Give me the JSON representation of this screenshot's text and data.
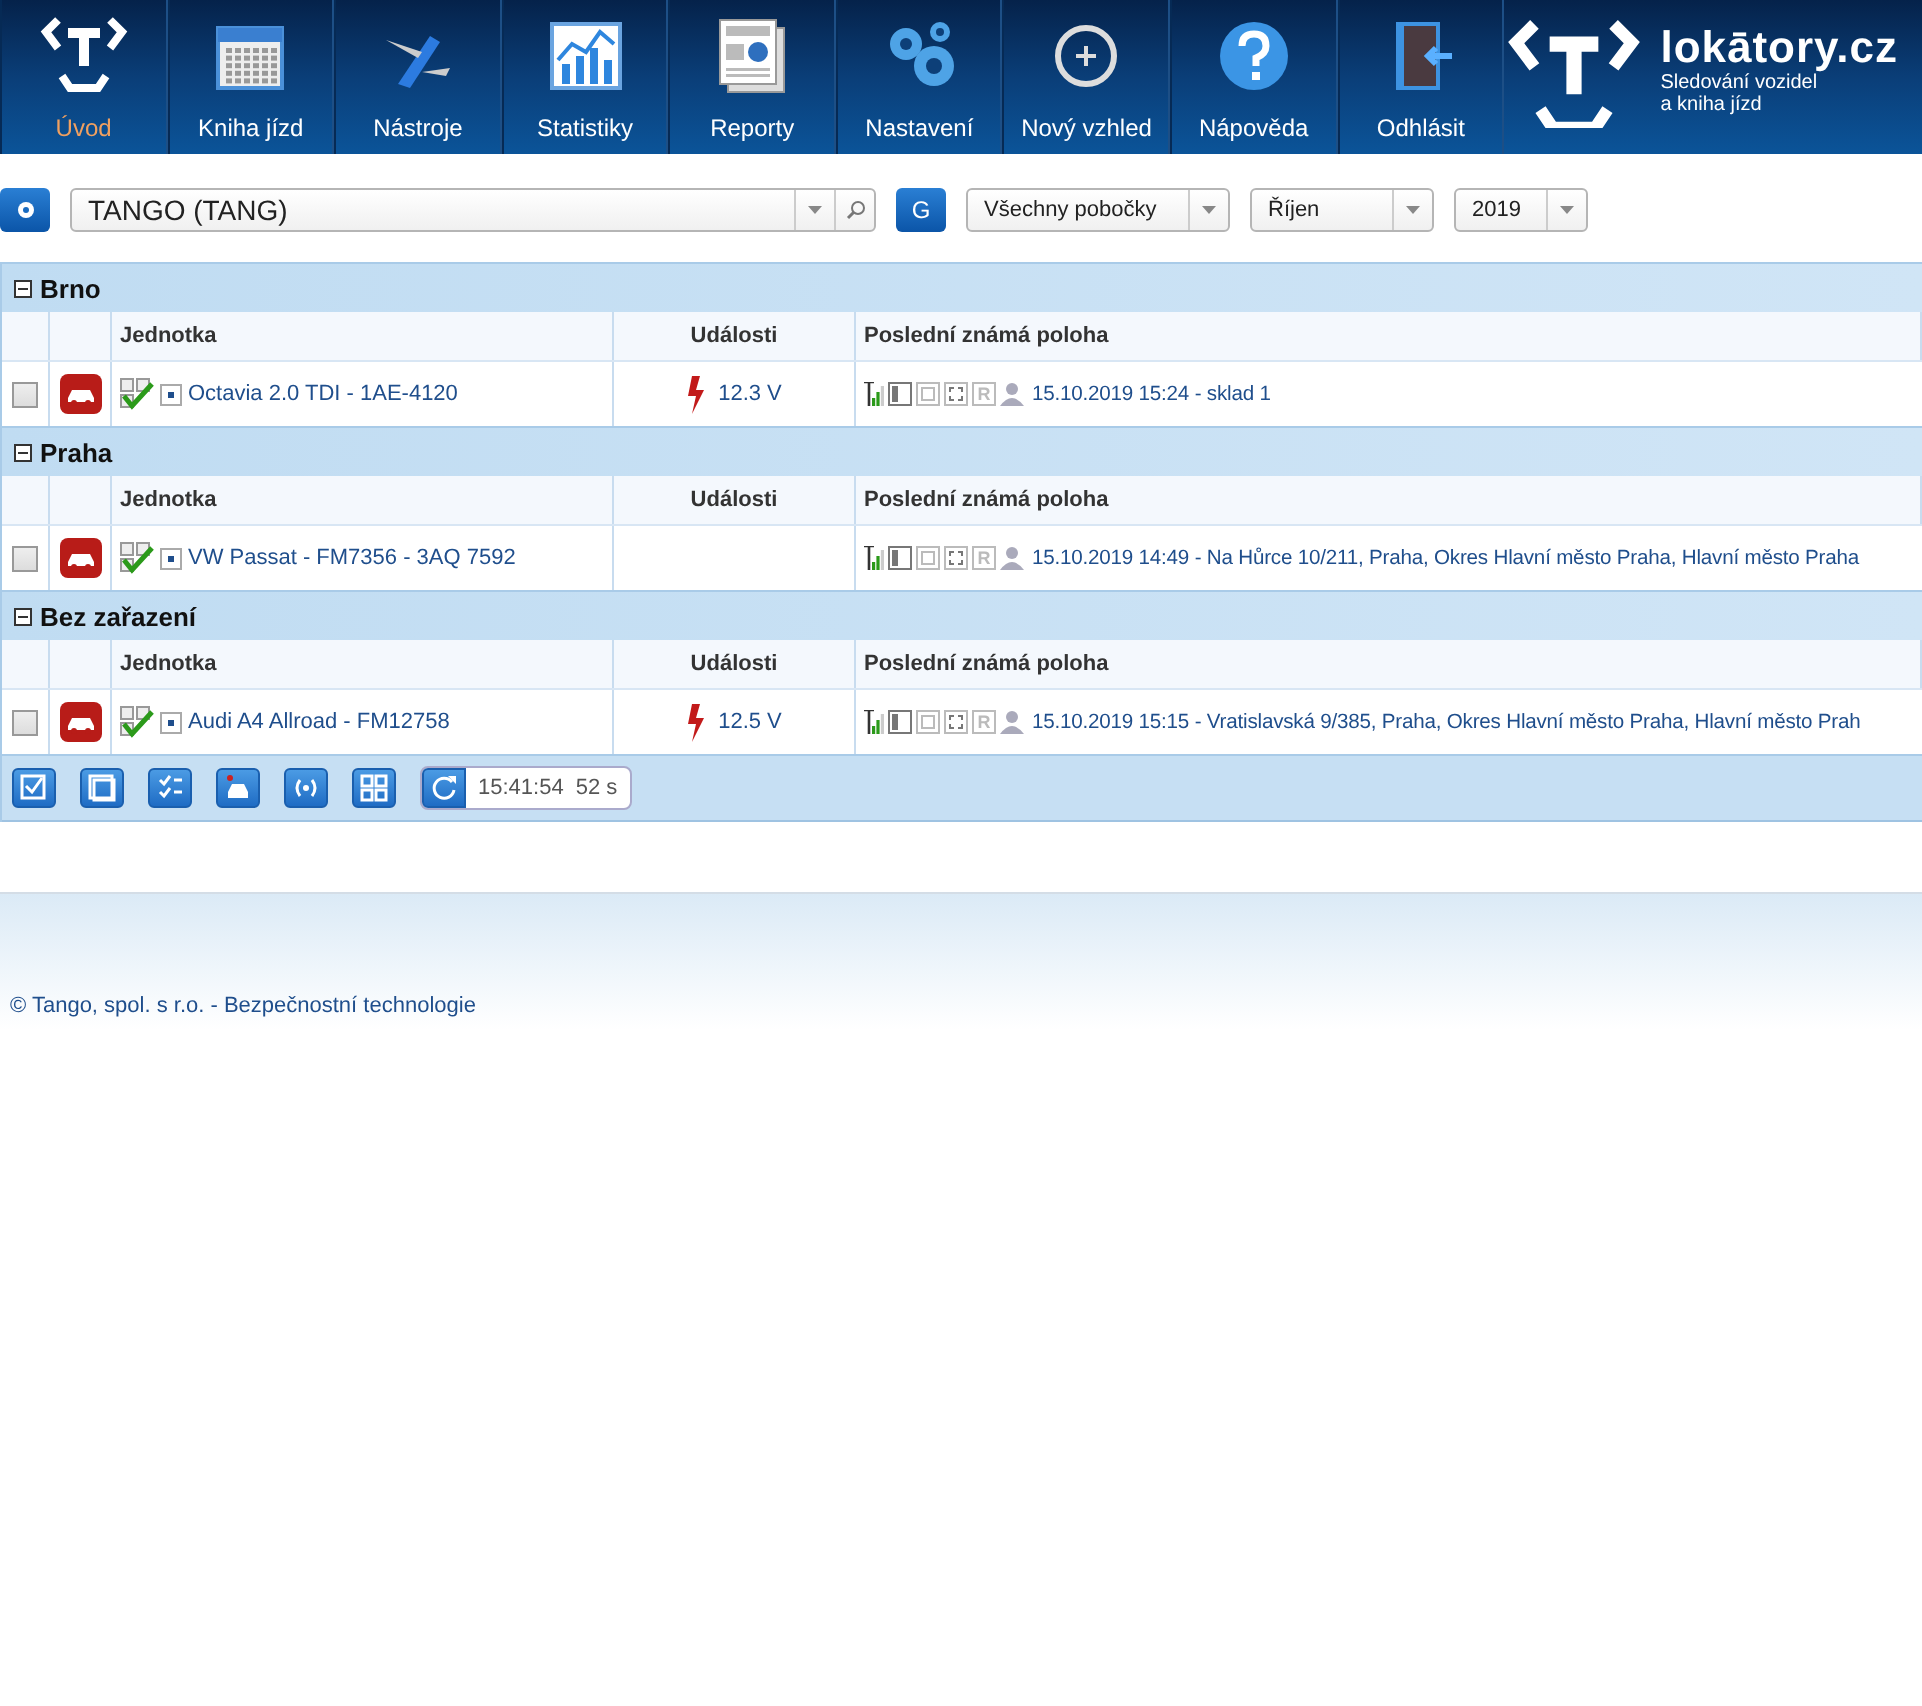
{
  "nav": [
    {
      "label": "Úvod",
      "selected": true
    },
    {
      "label": "Kniha jízd",
      "selected": false
    },
    {
      "label": "Nástroje",
      "selected": false
    },
    {
      "label": "Statistiky",
      "selected": false
    },
    {
      "label": "Reporty",
      "selected": false
    },
    {
      "label": "Nastavení",
      "selected": false
    },
    {
      "label": "Nový vzhled",
      "selected": false
    },
    {
      "label": "Nápověda",
      "selected": false
    },
    {
      "label": "Odhlásit",
      "selected": false
    }
  ],
  "logo": {
    "name": "lokātory.cz",
    "tagline_1": "Sledování vozidel",
    "tagline_2": "a kniha jízd"
  },
  "toolbar": {
    "company": "TANGO (TANG)",
    "g_button": "G",
    "branch": "Všechny pobočky",
    "month": "Říjen",
    "year": "2019"
  },
  "groups": [
    {
      "name": "Brno",
      "expanded": true,
      "columns": [
        "Jednotka",
        "Události",
        "Poslední známá poloha"
      ],
      "rows": [
        {
          "checked": false,
          "unit": "Octavia 2.0 TDI - 1AE-4120",
          "event": "12.3 V",
          "status_r": "R",
          "position": "15.10.2019 15:24 - sklad 1"
        }
      ]
    },
    {
      "name": "Praha",
      "expanded": true,
      "columns": [
        "Jednotka",
        "Události",
        "Poslední známá poloha"
      ],
      "rows": [
        {
          "checked": false,
          "unit": "VW Passat - FM7356 - 3AQ 7592",
          "status_r": "R",
          "position": "15.10.2019 14:49 - Na Hůrce 10/211, Praha, Okres Hlavní město Praha, Hlavní město Praha"
        }
      ]
    },
    {
      "name": "Bez zařazení",
      "expanded": true,
      "columns": [
        "Jednotka",
        "Události",
        "Poslední známá poloha"
      ],
      "rows": [
        {
          "checked": false,
          "unit": "Audi A4 Allroad - FM12758",
          "event": "12.5 V",
          "status_r": "R",
          "position": "15.10.2019 15:15 - Vratislavská 9/385, Praha, Okres Hlavní město Praha, Hlavní město Prah"
        }
      ]
    }
  ],
  "bottom_bar": {
    "time": "15:41:54",
    "countdown": "52 s"
  },
  "footer": "© Tango, spol. s r.o. - Bezpečnostní technologie"
}
